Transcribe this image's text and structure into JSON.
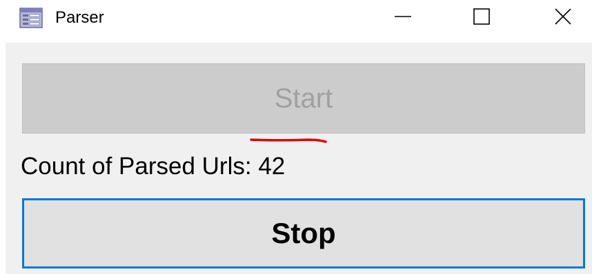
{
  "window": {
    "title": "Parser",
    "icon": "form-app-icon",
    "controls": {
      "minimize_icon": "minimize-icon",
      "maximize_icon": "maximize-icon",
      "close_icon": "close-icon"
    }
  },
  "main": {
    "start_label": "Start",
    "start_enabled": false,
    "count_label": "Count of Parsed Urls",
    "count_separator": ": ",
    "count_value": "42",
    "stop_label": "Stop",
    "stop_focused": true
  },
  "colors": {
    "focus_border": "#0078d7",
    "annotation_underline": "#e00000",
    "disabled_text": "#a0a0a0"
  }
}
